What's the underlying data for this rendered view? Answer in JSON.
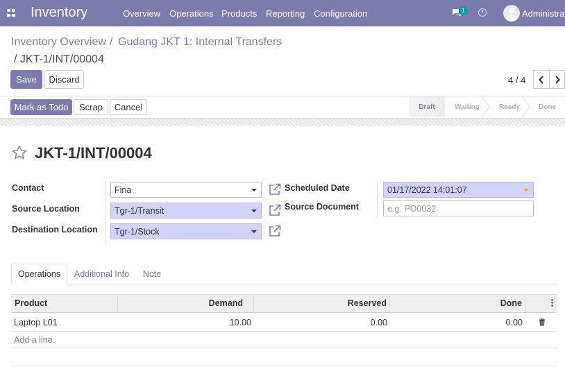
{
  "navbar": {
    "brand": "Inventory",
    "menu": [
      "Overview",
      "Operations",
      "Products",
      "Reporting",
      "Configuration"
    ],
    "chat_count": "1",
    "user": "Administrator"
  },
  "breadcrumb": {
    "items": [
      "Inventory Overview",
      "Gudang JKT 1: Internal Transfers"
    ],
    "separator": "/",
    "current": "/ JKT-1/INT/00004"
  },
  "buttons": {
    "save": "Save",
    "discard": "Discard",
    "mark_todo": "Mark as Todo",
    "scrap": "Scrap",
    "cancel": "Cancel"
  },
  "pager": {
    "text": "4 / 4"
  },
  "statusbar": {
    "stages": [
      "Draft",
      "Waiting",
      "Ready",
      "Done"
    ],
    "active": "Draft"
  },
  "record": {
    "title": "JKT-1/INT/00004",
    "fields": {
      "contact_label": "Contact",
      "contact_value": "Fina",
      "source_location_label": "Source Location",
      "source_location_value": "Tgr-1/Transit",
      "destination_location_label": "Destination Location",
      "destination_location_value": "Tgr-1/Stock",
      "scheduled_date_label": "Scheduled Date",
      "scheduled_date_value": "01/17/2022 14:01:07",
      "source_document_label": "Source Document",
      "source_document_placeholder": "e.g. PO0032"
    }
  },
  "tabs": [
    "Operations",
    "Additional Info",
    "Note"
  ],
  "table": {
    "headers": [
      "Product",
      "Demand",
      "Reserved",
      "Done"
    ],
    "rows": [
      {
        "product": "Laptop L01",
        "demand": "10.00",
        "reserved": "0.00",
        "done": "0.00"
      }
    ],
    "add_line": "Add a line"
  },
  "colors": {
    "primary": "#7c7bad",
    "required_field": "#d2d2ff"
  }
}
